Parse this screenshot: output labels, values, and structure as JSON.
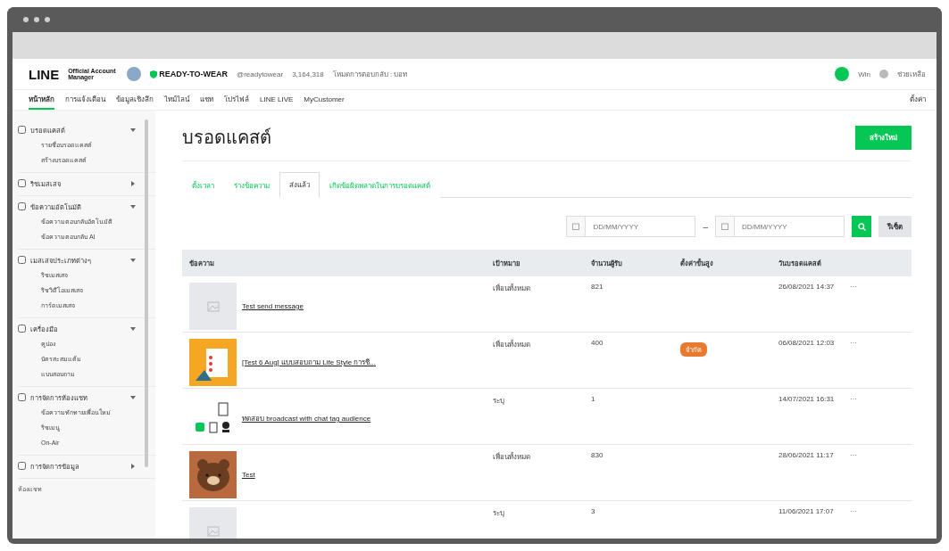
{
  "header": {
    "logo_main": "LINE",
    "logo_sub": "Official Account Manager",
    "account_name": "READY-TO-WEAR",
    "account_id": "@readytowear",
    "friends": "3,164,318",
    "response_mode": "โหมดการตอบกลับ : บอท",
    "user": "Win",
    "help": "ช่วยเหลือ"
  },
  "nav": {
    "items": [
      {
        "label": "หน้าหลัก",
        "selected": true
      },
      {
        "label": "การแจ้งเตือน",
        "selected": false
      },
      {
        "label": "ข้อมูลเชิงลึก",
        "selected": false
      },
      {
        "label": "ไทม์ไลน์",
        "selected": false
      },
      {
        "label": "แชท",
        "selected": false
      },
      {
        "label": "โปรไฟล์",
        "selected": false
      },
      {
        "label": "LINE LIVE",
        "selected": false
      },
      {
        "label": "MyCustomer",
        "selected": false
      }
    ],
    "settings": "ตั้งค่า"
  },
  "sidebar": {
    "groups": [
      {
        "label": "บรอดแคสต์",
        "expanded": true,
        "children": [
          {
            "label": "รายชื่อบรอดแคสต์"
          },
          {
            "label": "สร้างบรอดแคสต์"
          }
        ]
      },
      {
        "label": "ริชเมสเสจ",
        "expanded": false
      },
      {
        "label": "ข้อความอัตโนมัติ",
        "expanded": true,
        "children": [
          {
            "label": "ข้อความตอบกลับอัตโนมัติ"
          },
          {
            "label": "ข้อความตอบกลับ AI"
          }
        ]
      },
      {
        "label": "เมสเสจประเภทต่างๆ",
        "expanded": true,
        "children": [
          {
            "label": "ริชเมสเสจ"
          },
          {
            "label": "ริชวิดีโอเมสเสจ"
          },
          {
            "label": "การ์ดเมสเสจ"
          }
        ]
      },
      {
        "label": "เครื่องมือ",
        "expanded": true,
        "children": [
          {
            "label": "คูปอง"
          },
          {
            "label": "บัตรสะสมแต้ม"
          },
          {
            "label": "แบบสอบถาม"
          }
        ]
      },
      {
        "label": "การจัดการห้องแชท",
        "expanded": true,
        "children": [
          {
            "label": "ข้อความทักทายเพื่อนใหม่"
          },
          {
            "label": "ริชเมนู"
          },
          {
            "label": "On-Air"
          }
        ]
      },
      {
        "label": "การจัดการข้อมูล",
        "expanded": false
      }
    ],
    "footer": "ห้องแชท"
  },
  "page": {
    "title": "บรอดแคสต์",
    "create_button": "สร้างใหม่",
    "tabs": [
      {
        "label": "ตั้งเวลา",
        "selected": false
      },
      {
        "label": "ร่างข้อความ",
        "selected": false
      },
      {
        "label": "ส่งแล้ว",
        "selected": true
      },
      {
        "label": "เกิดข้อผิดพลาดในการบรอดแคสต์",
        "selected": false
      }
    ],
    "date_from": {
      "placeholder": "DD/MM/YYYY"
    },
    "date_to": {
      "placeholder": "DD/MM/YYYY"
    },
    "dash": "–",
    "reset_button": "รีเซ็ต"
  },
  "table": {
    "columns": [
      "ข้อความ",
      "เป้าหมาย",
      "จำนวนผู้รับ",
      "ตั้งค่าขั้นสูง",
      "วันบรอดแคสต์"
    ],
    "rows": [
      {
        "kind": "placeholder",
        "message": "Test send message",
        "target": "เพื่อนทั้งหมด",
        "recipients": "821",
        "date": "26/08/2021 14:37",
        "more": "···"
      },
      {
        "kind": "survey",
        "message": "[Test 6 Aug] แบบสอบถาม Life Style การชี...",
        "target": "เพื่อนทั้งหมด",
        "recipients": "400",
        "badge": "จำกัด",
        "date": "06/08/2021 12:03",
        "more": "···"
      },
      {
        "kind": "icons",
        "message": "ทดสอบ broadcast with chat tag audience",
        "target": "ระบุ",
        "recipients": "1",
        "date": "14/07/2021 16:31",
        "more": "···"
      },
      {
        "kind": "bear",
        "message": "Test",
        "target": "เพื่อนทั้งหมด",
        "recipients": "830",
        "date": "28/06/2021 11:17",
        "more": "···"
      },
      {
        "kind": "placeholder",
        "target": "ระบุ",
        "recipients": "3",
        "date": "11/06/2021 17:07",
        "more": "···"
      }
    ]
  }
}
